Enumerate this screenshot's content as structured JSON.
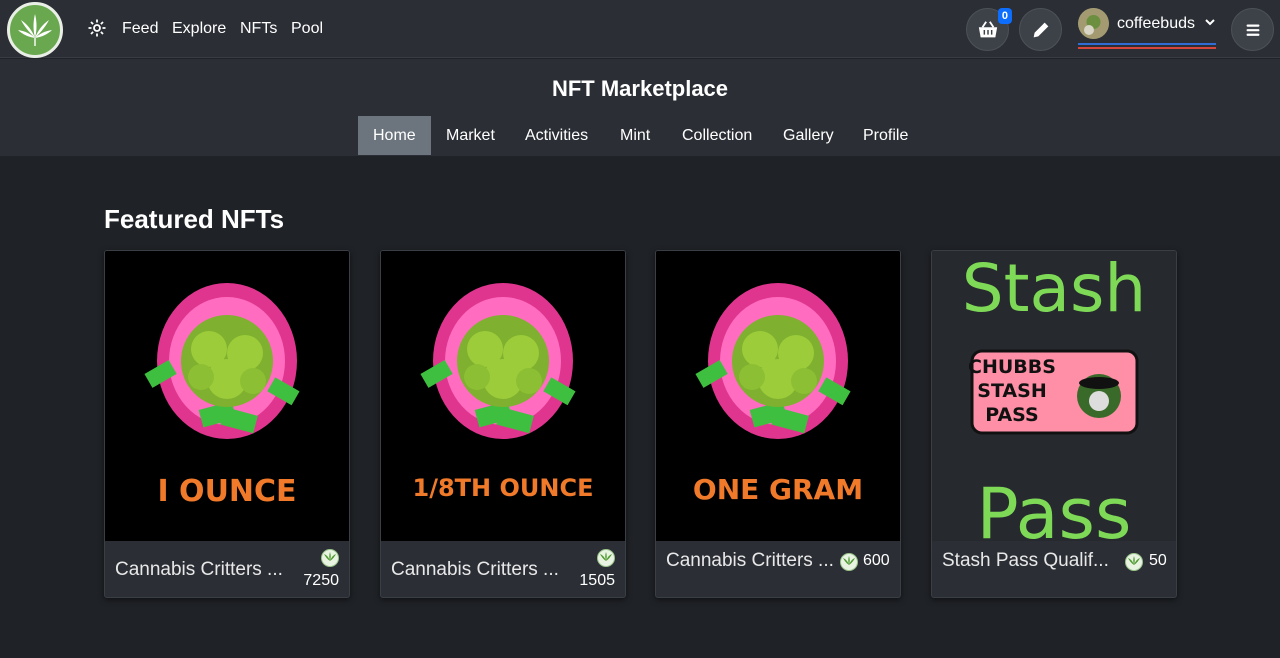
{
  "nav": {
    "links": [
      "Feed",
      "Explore",
      "NFTs",
      "Pool"
    ],
    "cart_count": "0",
    "username": "coffeebuds"
  },
  "page": {
    "title": "NFT Marketplace",
    "tabs": [
      "Home",
      "Market",
      "Activities",
      "Mint",
      "Collection",
      "Gallery",
      "Profile"
    ],
    "active_tab": "Home"
  },
  "featured": {
    "title": "Featured NFTs",
    "cards": [
      {
        "name": "Cannabis Critters ...",
        "price": "7250",
        "art_text": "I OUNCE"
      },
      {
        "name": "Cannabis Critters ...",
        "price": "1505",
        "art_text": "1/8TH OUNCE"
      },
      {
        "name": "Cannabis Critters ...",
        "price": "600",
        "art_text": "ONE GRAM"
      },
      {
        "name": "Stash Pass Qualif...",
        "price": "50",
        "art_top": "Stash",
        "art_ticket": [
          "CHUBBS",
          "STASH",
          "PASS"
        ],
        "art_bottom": "Pass"
      }
    ]
  },
  "colors": {
    "navbar": "#2b2f35",
    "page_bg": "#1f2227",
    "active_tab": "#6c757d",
    "cart_badge": "#0d6efd"
  }
}
